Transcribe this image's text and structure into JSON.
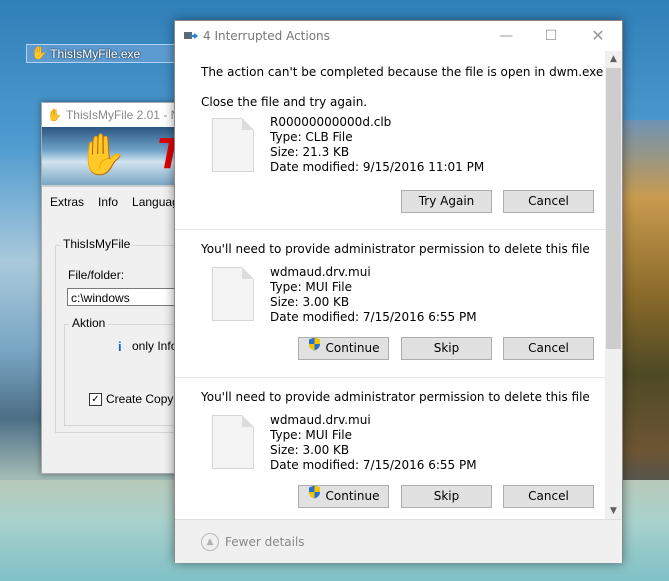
{
  "desktop": {
    "icon_label": "ThisIsMyFile.exe"
  },
  "app_window": {
    "title": "ThisIsMyFile 2.01 - N",
    "banner_text": "T",
    "menu": [
      "Extras",
      "Info",
      "Language"
    ],
    "group_label": "ThisIsMyFile",
    "folder_label": "File/folder:",
    "folder_value": "c:\\windows",
    "action_group_label": "Aktion",
    "only_info_label": "only Info",
    "create_copy_label": "Create Copy",
    "create_copy_checked": true
  },
  "dialog": {
    "title": "4 Interrupted Actions",
    "controls": {
      "minimize": "—",
      "maximize": "☐",
      "close": "✕"
    },
    "sections": [
      {
        "message": "The action can't be completed because the file is open in dwm.exe",
        "sub_message": "Close the file and try again.",
        "file": {
          "name": "R00000000000d.clb",
          "type": "Type: CLB File",
          "size": "Size: 21.3 KB",
          "date": "Date modified: 9/15/2016 11:01 PM"
        },
        "buttons": [
          "Try Again",
          "Cancel"
        ]
      },
      {
        "message": "You'll need to provide administrator permission to delete this file",
        "file": {
          "name": "wdmaud.drv.mui",
          "type": "Type: MUI File",
          "size": "Size: 3.00 KB",
          "date": "Date modified: 7/15/2016 6:55 PM"
        },
        "buttons": [
          "Continue",
          "Skip",
          "Cancel"
        ]
      },
      {
        "message": "You'll need to provide administrator permission to delete this file",
        "file": {
          "name": "wdmaud.drv.mui",
          "type": "Type: MUI File",
          "size": "Size: 3.00 KB",
          "date": "Date modified: 7/15/2016 6:55 PM"
        },
        "buttons": [
          "Continue",
          "Skip",
          "Cancel"
        ]
      }
    ],
    "footer": {
      "toggle_label": "Fewer details"
    }
  }
}
